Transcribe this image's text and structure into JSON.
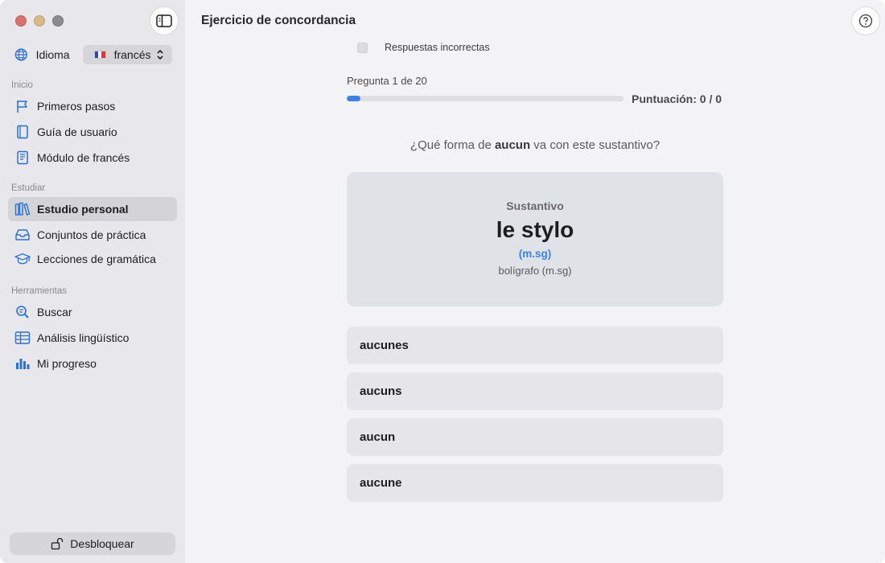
{
  "window": {
    "title": "Ejercicio de concordancia"
  },
  "sidebar": {
    "language_label": "Idioma",
    "language_value": "francés",
    "sections": [
      {
        "title": "Inicio"
      },
      {
        "title": "Estudiar"
      },
      {
        "title": "Herramientas"
      }
    ],
    "items": [
      {
        "label": "Primeros pasos",
        "icon": "flag-icon"
      },
      {
        "label": "Guía de usuario",
        "icon": "book-icon"
      },
      {
        "label": "Módulo de francés",
        "icon": "module-book-icon"
      },
      {
        "label": "Estudio personal",
        "icon": "books-icon",
        "active": true
      },
      {
        "label": "Conjuntos de práctica",
        "icon": "tray-icon"
      },
      {
        "label": "Lecciones de gramática",
        "icon": "graduation-cap-icon"
      },
      {
        "label": "Buscar",
        "icon": "magnifier-icon"
      },
      {
        "label": "Análisis lingüístico",
        "icon": "table-icon"
      },
      {
        "label": "Mi progreso",
        "icon": "bar-chart-icon"
      }
    ],
    "unlock_label": "Desbloquear"
  },
  "main": {
    "wrong_answers_label": "Respuestas incorrectas",
    "progress_label": "Pregunta 1 de 20",
    "progress_fraction": 0.05,
    "score_label": "Puntuación: 0 / 0",
    "question_prefix": "¿Qué forma de ",
    "question_word": "aucun",
    "question_suffix": " va con este sustantivo?",
    "card": {
      "kind": "Sustantivo",
      "word": "le stylo",
      "gender": "(m.sg)",
      "translation": "bolígrafo (m.sg)"
    },
    "options": [
      "aucunes",
      "aucuns",
      "aucun",
      "aucune"
    ]
  },
  "colors": {
    "accent": "#3b82e6",
    "sidebar_bg": "#e8e8ec",
    "card_bg": "#dfe3e7"
  }
}
